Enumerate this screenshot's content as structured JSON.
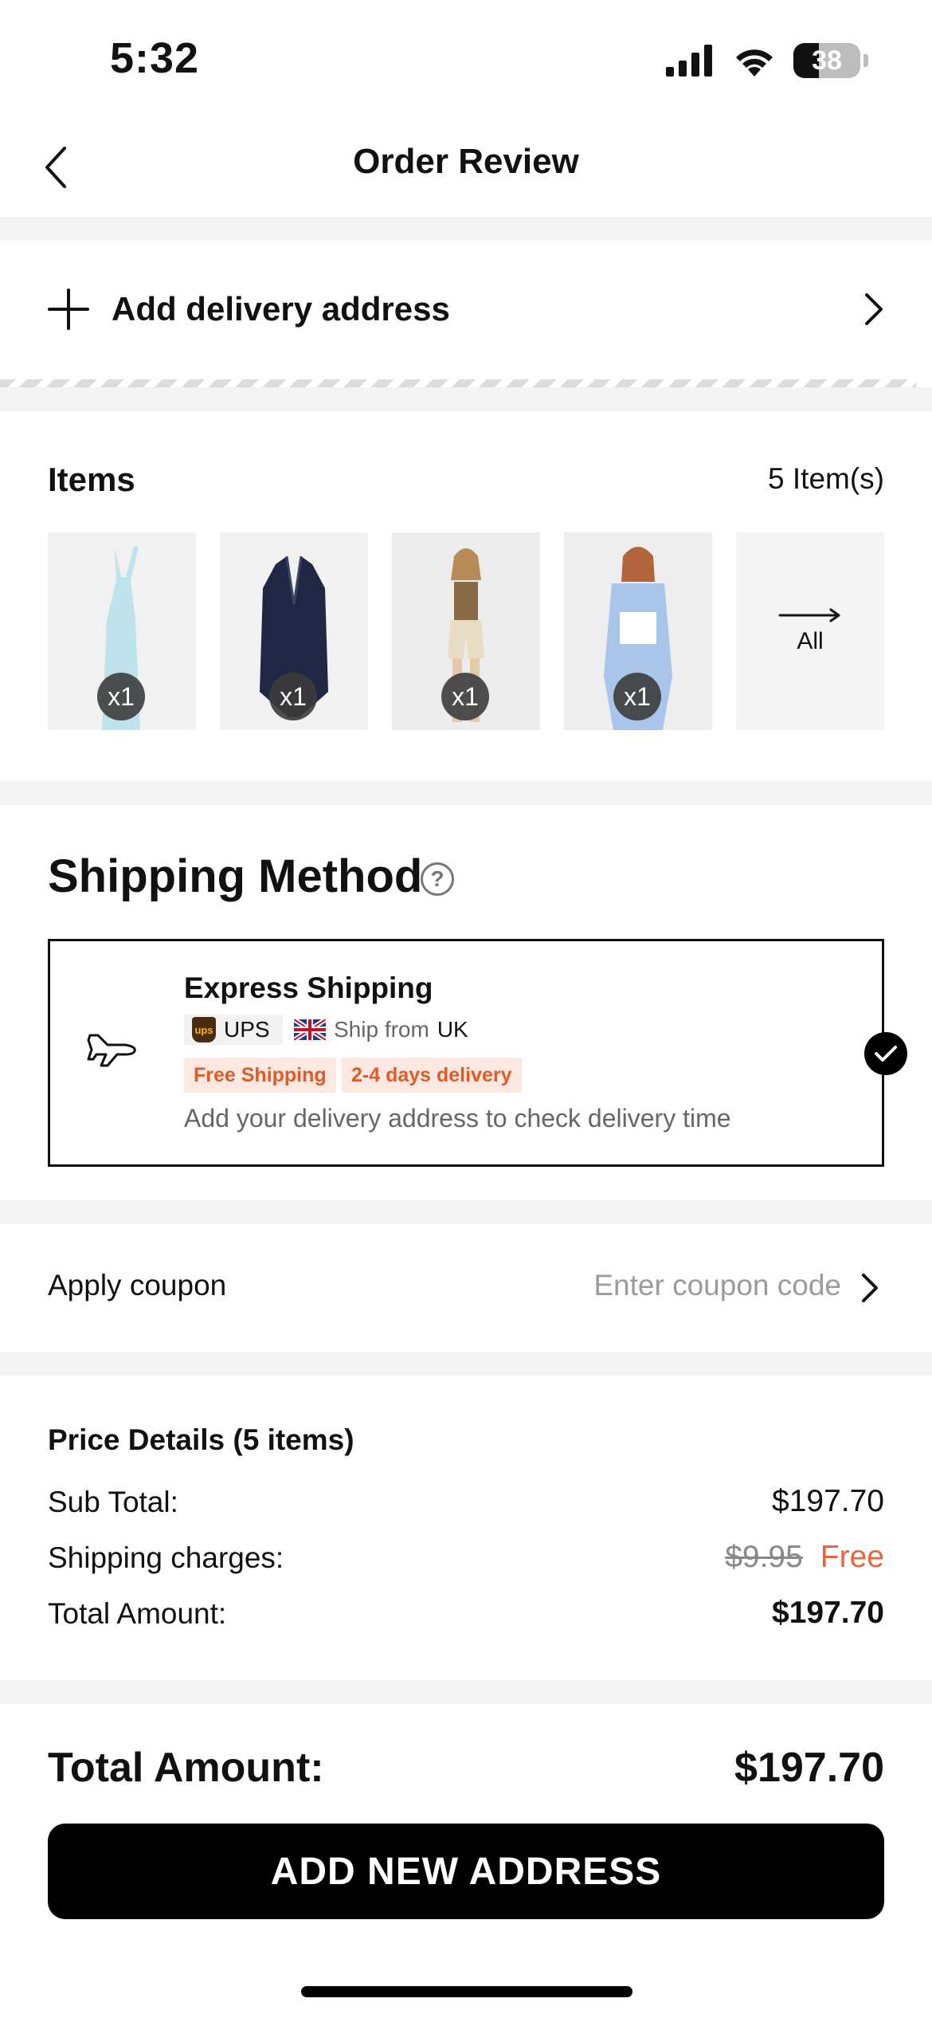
{
  "status_bar": {
    "time": "5:32",
    "battery": "38",
    "icons": [
      "signal-icon",
      "wifi-icon",
      "battery-icon"
    ]
  },
  "header": {
    "title": "Order Review",
    "back_icon": "chevron-left-icon"
  },
  "address": {
    "label": "Add delivery address",
    "icon": "plus-icon"
  },
  "items": {
    "title": "Items",
    "count": "5 Item(s)",
    "products": [
      {
        "image": "light-blue-knit-dress",
        "qty": "x1"
      },
      {
        "image": "navy-halter-vest",
        "qty": "x1"
      },
      {
        "image": "brown-tank-beige-shorts-outfit",
        "qty": "x1"
      },
      {
        "image": "blue-shirt-white-corset-outfit",
        "qty": "x1"
      }
    ],
    "view_all": "All"
  },
  "shipping": {
    "title": "Shipping Method",
    "option": {
      "name": "Express Shipping",
      "carrier": "UPS",
      "origin_prefix": "Ship from",
      "origin_country": "UK",
      "tags": [
        "Free Shipping",
        "2-4 days delivery"
      ],
      "note": "Add your delivery address to check delivery time",
      "selected": true
    }
  },
  "coupon": {
    "label": "Apply coupon",
    "placeholder": "Enter coupon code"
  },
  "price_details": {
    "title": "Price Details (5 items)",
    "subtotal_label": "Sub Total:",
    "subtotal_value": "$197.70",
    "shipping_label": "Shipping charges:",
    "shipping_original": "$9.95",
    "shipping_value": "Free",
    "total_label": "Total Amount:",
    "total_value": "$197.70"
  },
  "footer": {
    "total_label": "Total Amount:",
    "total_value": "$197.70",
    "cta": "ADD NEW ADDRESS"
  },
  "colors": {
    "accent_orange": "#e8663a",
    "tag_bg": "#fde8e2",
    "primary": "#000000"
  }
}
